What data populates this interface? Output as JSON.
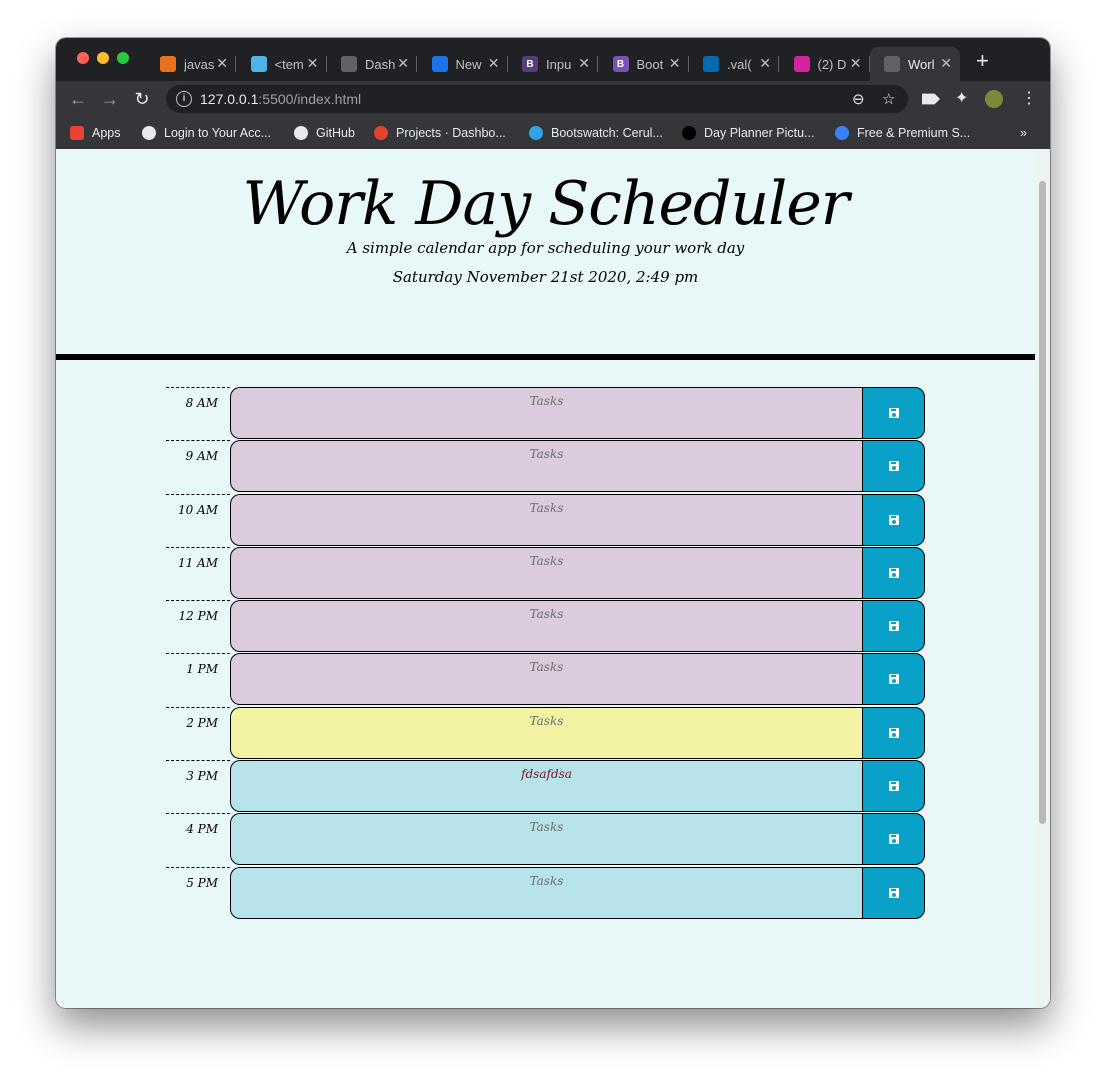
{
  "browser": {
    "tabs": [
      {
        "title": "javas",
        "fav_color": "#e8711a",
        "fav_glyph": ""
      },
      {
        "title": "<tem",
        "fav_color": "#4fb3e8",
        "fav_glyph": ""
      },
      {
        "title": "Dash",
        "fav_color": "#5f6368",
        "fav_glyph": ""
      },
      {
        "title": "New",
        "fav_color": "#1a73e8",
        "fav_glyph": ""
      },
      {
        "title": "Inpu",
        "fav_color": "#563d7c",
        "fav_glyph": "B"
      },
      {
        "title": "Boot",
        "fav_color": "#7952b3",
        "fav_glyph": "B"
      },
      {
        "title": ".val(",
        "fav_color": "#0769ad",
        "fav_glyph": ""
      },
      {
        "title": "(2) D",
        "fav_color": "#d6249f",
        "fav_glyph": ""
      },
      {
        "title": "Worl",
        "fav_color": "#5f6368",
        "fav_glyph": ""
      }
    ],
    "url_host": "127.0.0.1",
    "url_rest": ":5500/index.html",
    "bookmarks": [
      {
        "label": "Apps",
        "color": "#ea4335"
      },
      {
        "label": "Login to Your Acc...",
        "color": "#e8eaed"
      },
      {
        "label": "GitHub",
        "color": "#e8eaed"
      },
      {
        "label": "Projects · Dashbo...",
        "color": "#e24329"
      },
      {
        "label": "Bootswatch: Cerul...",
        "color": "#2fa4e7"
      },
      {
        "label": "Day Planner Pictu...",
        "color": "#000000"
      },
      {
        "label": "Free & Premium S...",
        "color": "#3b82f6"
      }
    ],
    "overflow": "»"
  },
  "header": {
    "title": "Work Day Scheduler",
    "lead": "A simple calendar app for scheduling your work day",
    "date": "Saturday November 21st 2020, 2:49 pm"
  },
  "schedule": [
    {
      "hour": "8 AM",
      "text": "Tasks",
      "state": "past"
    },
    {
      "hour": "9 AM",
      "text": "Tasks",
      "state": "past"
    },
    {
      "hour": "10 AM",
      "text": "Tasks",
      "state": "past"
    },
    {
      "hour": "11 AM",
      "text": "Tasks",
      "state": "past"
    },
    {
      "hour": "12 PM",
      "text": "Tasks",
      "state": "past"
    },
    {
      "hour": "1 PM",
      "text": "Tasks",
      "state": "past"
    },
    {
      "hour": "2 PM",
      "text": "Tasks",
      "state": "present"
    },
    {
      "hour": "3 PM",
      "text": "fdsafdsa",
      "state": "future"
    },
    {
      "hour": "4 PM",
      "text": "Tasks",
      "state": "future"
    },
    {
      "hour": "5 PM",
      "text": "Tasks",
      "state": "future"
    }
  ]
}
